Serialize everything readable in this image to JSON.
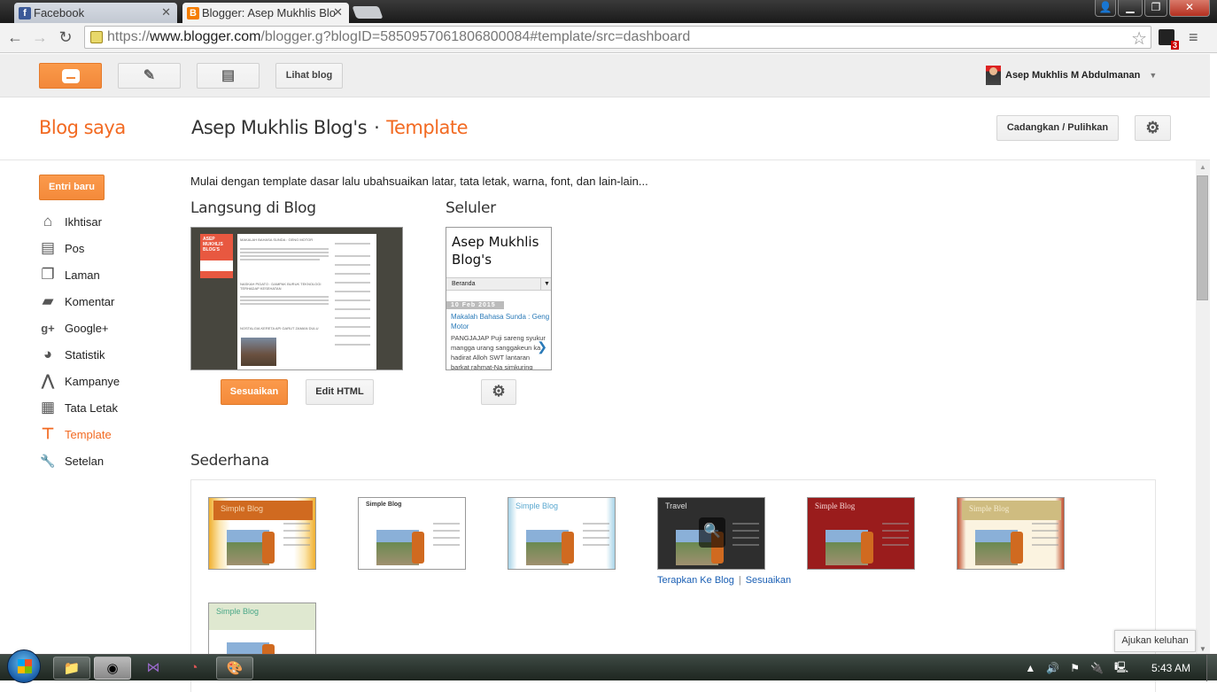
{
  "browser": {
    "tabs": [
      {
        "label": "Facebook",
        "icon": "facebook-icon",
        "active": false
      },
      {
        "label": "Blogger: Asep Mukhlis Blo",
        "icon": "blogger-icon",
        "active": true
      }
    ],
    "url_prefix": "https://",
    "url_host": "www.blogger.com",
    "url_rest": "/blogger.g?blogID=5850957061806800084#template/src=dashboard",
    "extension_badge": "3"
  },
  "header": {
    "view_blog_label": "Lihat blog",
    "user_name": "Asep Mukhlis M Abdulmanan"
  },
  "titlebar": {
    "my_blogs": "Blog saya",
    "blog_name": "Asep Mukhlis Blog's",
    "separator": "·",
    "section": "Template",
    "backup_label": "Cadangkan / Pulihkan"
  },
  "sidebar": {
    "new_post_label": "Entri baru",
    "items": [
      {
        "label": "Ikhtisar",
        "icon": "home-icon",
        "glyph": "⌂"
      },
      {
        "label": "Pos",
        "icon": "posts-icon",
        "glyph": "▤"
      },
      {
        "label": "Laman",
        "icon": "pages-icon",
        "glyph": "❐"
      },
      {
        "label": "Komentar",
        "icon": "comment-icon",
        "glyph": "▰"
      },
      {
        "label": "Google+",
        "icon": "google-plus-icon",
        "glyph": "g+"
      },
      {
        "label": "Statistik",
        "icon": "pie-chart-icon",
        "glyph": "◕"
      },
      {
        "label": "Kampanye",
        "icon": "adwords-icon",
        "glyph": "⋀"
      },
      {
        "label": "Tata Letak",
        "icon": "layout-icon",
        "glyph": "▦"
      },
      {
        "label": "Template",
        "icon": "paint-roller-icon",
        "glyph": "⊤",
        "active": true
      },
      {
        "label": "Setelan",
        "icon": "wrench-icon",
        "glyph": "🔧"
      }
    ]
  },
  "main": {
    "intro": "Mulai dengan template dasar lalu ubahsuaikan latar, tata letak, warna, font, dan lain-lain...",
    "live_heading": "Langsung di Blog",
    "mobile_heading": "Seluler",
    "customize_label": "Sesuaikan",
    "edit_html_label": "Edit HTML",
    "live_preview": {
      "sidebar_title": "ASEP MUKHLIS BLOG'S",
      "posts": [
        "MAKALAH BAHASA SUNDA : GENG MOTOR",
        "NASKAH PIDATO : DAMPAK BURUK TEKNOLOGI TERHADAP KESEHATAN",
        "NOSTALGIA KERETA API GARUT ZAMAN DULU"
      ]
    },
    "mobile_preview": {
      "title": "Asep Mukhlis Blog's",
      "nav": "Beranda",
      "date": "10 Feb 2015",
      "post_title": "Makalah Bahasa Sunda : Geng Motor",
      "post_body": "PANGJAJAP Puji sareng syukur mangga urang sanggakeun ka hadirat Alloh SWT lantaran barkat rahmat-Na simkuring sanggakeun tiasa..."
    },
    "simple_heading": "Sederhana",
    "templates": [
      {
        "title": "Simple Blog",
        "theme": "orange"
      },
      {
        "title": "Simple Blog",
        "theme": "white"
      },
      {
        "title": "Simple Blog",
        "theme": "light-blue"
      },
      {
        "title": "Travel",
        "theme": "dark",
        "hovered": true
      },
      {
        "title": "Simple Blog",
        "theme": "red"
      },
      {
        "title": "Simple Blog",
        "theme": "beige"
      },
      {
        "title": "Simple Blog",
        "theme": "green"
      }
    ],
    "apply_label": "Terapkan Ke Blog",
    "customize_link_label": "Sesuaikan",
    "feedback_label": "Ajukan keluhan"
  },
  "taskbar": {
    "clock": "5:43 AM",
    "apps": [
      "explorer-icon",
      "chrome-icon",
      "visual-studio-icon",
      "speedometer-icon",
      "paint-icon"
    ]
  },
  "colors": {
    "accent": "#f26a22",
    "button_orange": "#f48a3a",
    "link_blue": "#1a5fb4"
  }
}
